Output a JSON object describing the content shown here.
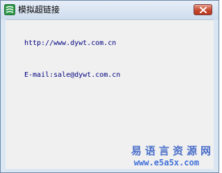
{
  "window": {
    "title": "模拟超链接",
    "close_label": "×"
  },
  "content": {
    "link1": "http://www.dywt.com.cn",
    "link2": "E-mail:sale@dywt.com.cn"
  },
  "watermark": {
    "cn": "易语言资源网",
    "url": "www.e5a5x.com"
  },
  "colors": {
    "link": "#000080",
    "watermark": "#4a6fc9",
    "close": "#c4462d"
  },
  "icons": [
    "app-logo-icon",
    "close-icon"
  ]
}
